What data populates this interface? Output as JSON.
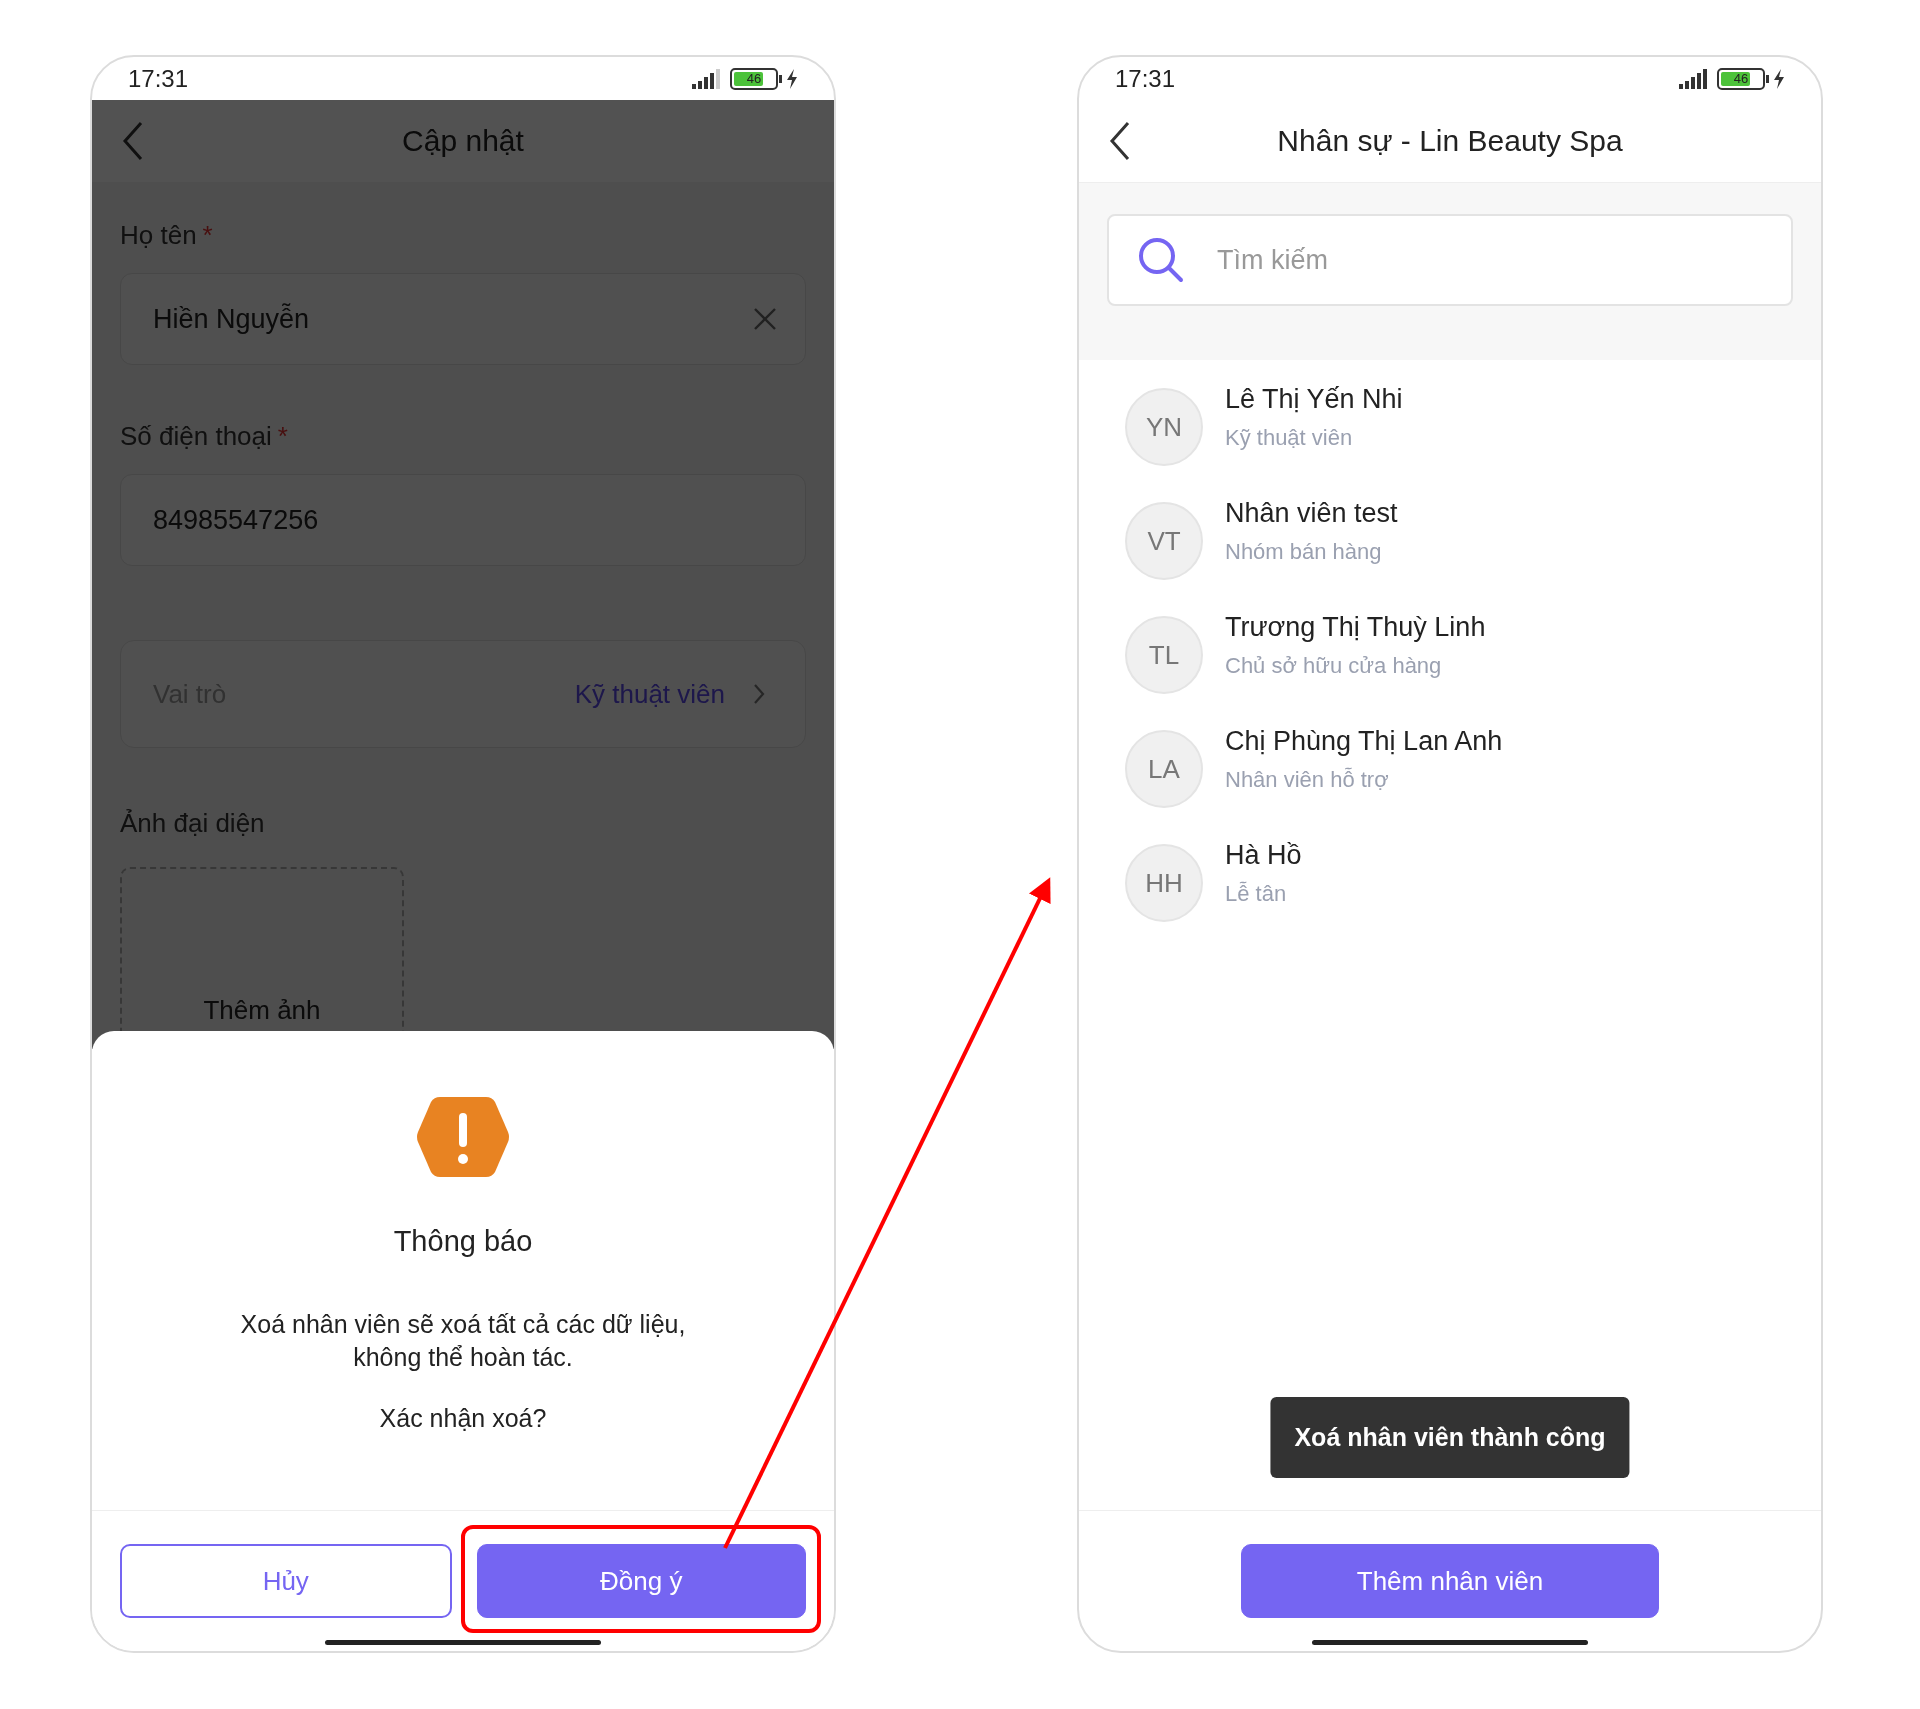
{
  "left_screen": {
    "status": {
      "time": "17:31",
      "battery": "46"
    },
    "header": {
      "title": "Cập nhật"
    },
    "fields": [
      {
        "label": "Họ tên",
        "required_mark": "*",
        "value": "Hiền Nguyễn",
        "clearable": true
      },
      {
        "label": "Số điện thoại",
        "required_mark": "*",
        "value": "84985547256",
        "clearable": false
      }
    ],
    "role": {
      "label": "Vai trò",
      "value": "Kỹ thuật viên"
    },
    "avatar": {
      "label": "Ảnh đại diện",
      "upload": "Thêm ảnh"
    },
    "dialog": {
      "title": "Thông báo",
      "message": "Xoá nhân viên sẽ xoá tất cả các dữ liệu,\nkhông thể hoàn tác.",
      "question": "Xác nhận xoá?",
      "buttons": [
        {
          "label": "Hủy",
          "kind": "secondary"
        },
        {
          "label": "Đồng ý",
          "kind": "primary"
        }
      ]
    }
  },
  "right_screen": {
    "status": {
      "time": "17:31",
      "battery": "46"
    },
    "header": {
      "title": "Nhân sự - Lin Beauty Spa"
    },
    "search": {
      "placeholder": "Tìm kiếm"
    },
    "staff": [
      {
        "initials": "YN",
        "name": "Lê Thị Yến Nhi",
        "role": "Kỹ thuật viên"
      },
      {
        "initials": "VT",
        "name": "Nhân viên test",
        "role": "Nhóm bán hàng"
      },
      {
        "initials": "TL",
        "name": "Trương Thị Thuỳ Linh",
        "role": "Chủ sở hữu cửa hàng"
      },
      {
        "initials": "LA",
        "name": "Chị Phùng Thị Lan Anh",
        "role": "Nhân viên hỗ trợ"
      },
      {
        "initials": "HH",
        "name": "Hà Hồ",
        "role": "Lễ tân"
      }
    ],
    "toast": "Xoá nhân viên thành công",
    "button": "Thêm nhân viên"
  }
}
